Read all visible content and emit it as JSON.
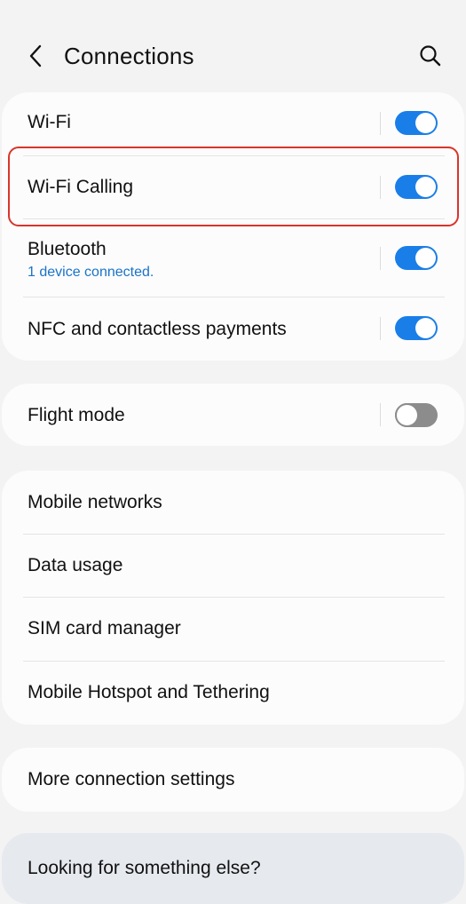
{
  "header": {
    "title": "Connections"
  },
  "connections": {
    "wifi": {
      "label": "Wi-Fi",
      "state": "on"
    },
    "wifi_calling": {
      "label": "Wi-Fi Calling",
      "state": "on"
    },
    "bluetooth": {
      "label": "Bluetooth",
      "sub": "1 device connected.",
      "state": "on"
    },
    "nfc": {
      "label": "NFC and contactless payments",
      "state": "on"
    }
  },
  "flight": {
    "label": "Flight mode",
    "state": "off"
  },
  "networks": {
    "mobile_networks": "Mobile networks",
    "data_usage": "Data usage",
    "sim_manager": "SIM card manager",
    "hotspot": "Mobile Hotspot and Tethering"
  },
  "more": {
    "label": "More connection settings"
  },
  "suggest": {
    "label": "Looking for something else?"
  },
  "colors": {
    "accent": "#1a7ee8",
    "link": "#1a73c8",
    "highlight": "#d9352a"
  },
  "icons": {
    "back": "chevron-left-icon",
    "search": "search-icon"
  }
}
